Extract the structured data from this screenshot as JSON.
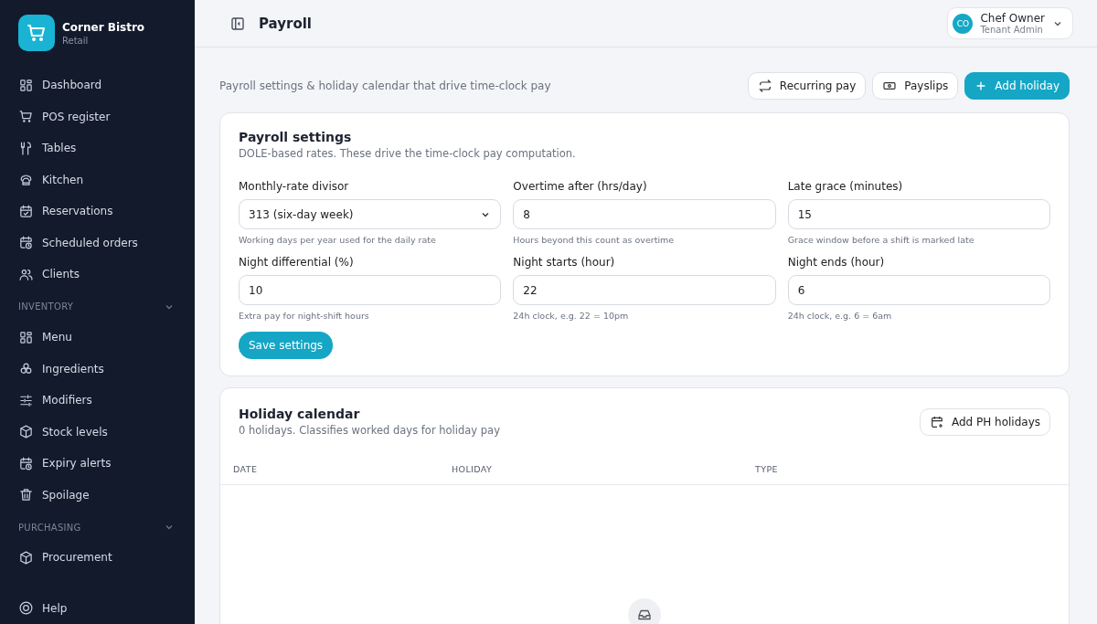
{
  "brand": {
    "name": "Corner Bistro",
    "subtitle": "Retail"
  },
  "sidebar": {
    "groups": [
      {
        "items": [
          {
            "label": "Dashboard"
          },
          {
            "label": "POS register"
          },
          {
            "label": "Tables"
          },
          {
            "label": "Kitchen"
          },
          {
            "label": "Reservations"
          },
          {
            "label": "Scheduled orders"
          },
          {
            "label": "Clients"
          }
        ]
      },
      {
        "heading": "INVENTORY",
        "expanded": true,
        "items": [
          {
            "label": "Menu"
          },
          {
            "label": "Ingredients"
          },
          {
            "label": "Modifiers"
          },
          {
            "label": "Stock levels"
          },
          {
            "label": "Expiry alerts"
          },
          {
            "label": "Spoilage"
          }
        ]
      },
      {
        "heading": "PURCHASING",
        "expanded": true,
        "items": [
          {
            "label": "Procurement"
          }
        ]
      },
      {
        "items": [
          {
            "label": "Help"
          }
        ]
      }
    ]
  },
  "header": {
    "title": "Payroll",
    "user": {
      "initials": "CO",
      "name": "Chef Owner",
      "role": "Tenant Admin"
    }
  },
  "page": {
    "description": "Payroll settings & holiday calendar that drive time-clock pay",
    "actions": [
      {
        "label": "Recurring pay",
        "kind": "secondary"
      },
      {
        "label": "Payslips",
        "kind": "secondary"
      },
      {
        "label": "Add holiday",
        "kind": "primary"
      }
    ]
  },
  "settings": {
    "title": "Payroll settings",
    "subtitle": "DOLE-based rates. These drive the time-clock pay computation.",
    "fields": [
      {
        "label": "Monthly-rate divisor",
        "kind": "select",
        "value": "313 (six-day week)",
        "hint": "Working days per year used for the daily rate"
      },
      {
        "label": "Overtime after (hrs/day)",
        "kind": "input",
        "value": "8",
        "hint": "Hours beyond this count as overtime"
      },
      {
        "label": "Late grace (minutes)",
        "kind": "input",
        "value": "15",
        "hint": "Grace window before a shift is marked late"
      },
      {
        "label": "Night differential (%)",
        "kind": "input",
        "value": "10",
        "hint": "Extra pay for night-shift hours"
      },
      {
        "label": "Night starts (hour)",
        "kind": "input",
        "value": "22",
        "hint": "24h clock, e.g. 22 = 10pm"
      },
      {
        "label": "Night ends (hour)",
        "kind": "input",
        "value": "6",
        "hint": "24h clock, e.g. 6 = 6am"
      }
    ],
    "save": "Save settings"
  },
  "holidays": {
    "title": "Holiday calendar",
    "subtitle": "0 holidays. Classifies worked days for holiday pay",
    "action": "Add PH holidays",
    "columns": [
      "DATE",
      "HOLIDAY",
      "TYPE"
    ]
  }
}
